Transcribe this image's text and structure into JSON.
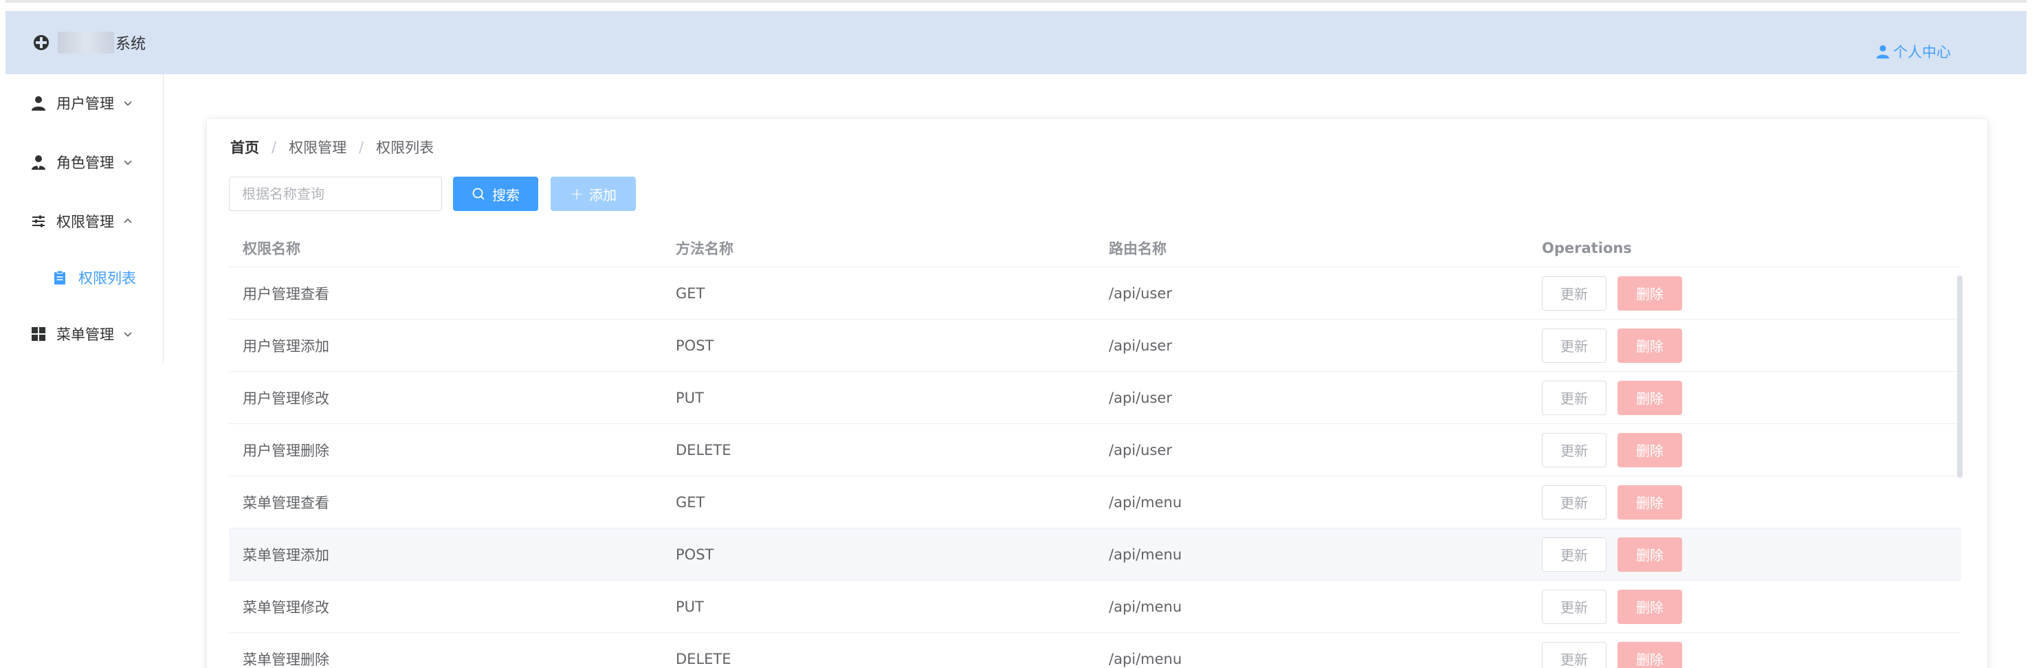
{
  "header": {
    "app_title": "系统",
    "user_center": "个人中心"
  },
  "sidebar": {
    "items": [
      {
        "label": "用户管理",
        "icon": "user-icon",
        "expanded": false
      },
      {
        "label": "角色管理",
        "icon": "role-icon",
        "expanded": false
      },
      {
        "label": "权限管理",
        "icon": "sliders-icon",
        "expanded": true
      },
      {
        "label": "菜单管理",
        "icon": "grid-icon",
        "expanded": false
      }
    ],
    "sub_items": [
      {
        "label": "权限列表",
        "icon": "clipboard-icon",
        "active": true
      }
    ]
  },
  "breadcrumb": {
    "home": "首页",
    "separator": "/",
    "level1": "权限管理",
    "level2": "权限列表"
  },
  "toolbar": {
    "search_placeholder": "根据名称查询",
    "search_value": "",
    "search_label": "搜索",
    "add_label": "添加",
    "add_disabled": true
  },
  "table": {
    "columns": [
      "权限名称",
      "方法名称",
      "路由名称",
      "Operations"
    ],
    "rows": [
      {
        "name": "用户管理查看",
        "method": "GET",
        "route": "/api/user"
      },
      {
        "name": "用户管理添加",
        "method": "POST",
        "route": "/api/user"
      },
      {
        "name": "用户管理修改",
        "method": "PUT",
        "route": "/api/user"
      },
      {
        "name": "用户管理删除",
        "method": "DELETE",
        "route": "/api/user"
      },
      {
        "name": "菜单管理查看",
        "method": "GET",
        "route": "/api/menu"
      },
      {
        "name": "菜单管理添加",
        "method": "POST",
        "route": "/api/menu"
      },
      {
        "name": "菜单管理修改",
        "method": "PUT",
        "route": "/api/menu"
      },
      {
        "name": "菜单管理删除",
        "method": "DELETE",
        "route": "/api/menu"
      }
    ],
    "update_label": "更新",
    "delete_label": "删除",
    "hover_row_index": 5
  },
  "colors": {
    "header_bg": "#d7e2f3",
    "primary": "#409eff",
    "primary_disabled": "#a0cfff",
    "danger_disabled": "#fab6b6"
  }
}
